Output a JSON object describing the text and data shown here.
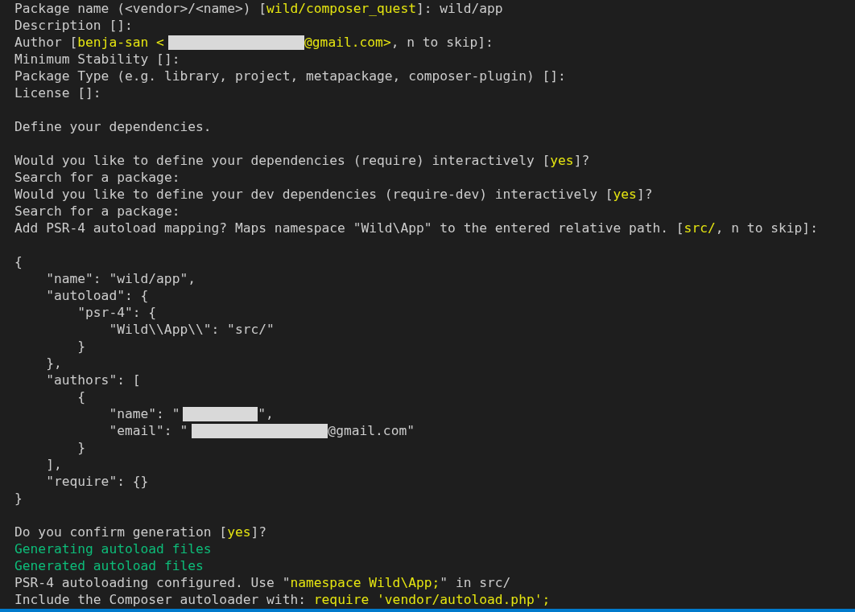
{
  "terminal": {
    "blocks": [
      {
        "lines": [
          {
            "segments": [
              {
                "kind": "plain",
                "text": "Package name (<vendor>/<name>) ["
              },
              {
                "kind": "accent",
                "text": "wild/composer_quest"
              },
              {
                "kind": "plain",
                "text": "]: wild/app"
              }
            ]
          },
          {
            "segments": [
              {
                "kind": "plain",
                "text": "Description []:"
              }
            ]
          },
          {
            "segments": [
              {
                "kind": "plain",
                "text": "Author ["
              },
              {
                "kind": "accent",
                "text": "benja-san <"
              },
              {
                "kind": "redacted"
              },
              {
                "kind": "accent",
                "text": "@gmail.com>"
              },
              {
                "kind": "plain",
                "text": ", n to skip]:"
              }
            ]
          },
          {
            "segments": [
              {
                "kind": "plain",
                "text": "Minimum Stability []:"
              }
            ]
          },
          {
            "segments": [
              {
                "kind": "plain",
                "text": "Package Type (e.g. library, project, metapackage, composer-plugin) []:"
              }
            ]
          },
          {
            "segments": [
              {
                "kind": "plain",
                "text": "License []:"
              }
            ]
          }
        ]
      },
      {
        "lines": [
          {
            "segments": [
              {
                "kind": "plain",
                "text": "Define your dependencies."
              }
            ]
          }
        ]
      },
      {
        "lines": [
          {
            "segments": [
              {
                "kind": "plain",
                "text": "Would you like to define your dependencies (require) interactively ["
              },
              {
                "kind": "accent",
                "text": "yes"
              },
              {
                "kind": "plain",
                "text": "]?"
              }
            ]
          },
          {
            "segments": [
              {
                "kind": "plain",
                "text": "Search for a package:"
              }
            ]
          },
          {
            "segments": [
              {
                "kind": "plain",
                "text": "Would you like to define your dev dependencies (require-dev) interactively ["
              },
              {
                "kind": "accent",
                "text": "yes"
              },
              {
                "kind": "plain",
                "text": "]?"
              }
            ]
          },
          {
            "segments": [
              {
                "kind": "plain",
                "text": "Search for a package:"
              }
            ]
          },
          {
            "segments": [
              {
                "kind": "plain",
                "text": "Add PSR-4 autoload mapping? Maps namespace \"Wild\\App\" to the entered relative path. ["
              },
              {
                "kind": "accent",
                "text": "src/"
              },
              {
                "kind": "plain",
                "text": ", n to skip]:"
              }
            ]
          }
        ]
      },
      {
        "lines": [
          {
            "segments": [
              {
                "kind": "plain",
                "text": "{"
              }
            ],
            "children": [
              {
                "segments": [
                  {
                    "kind": "plain",
                    "text": "\"name\": \"wild/app\","
                  }
                ]
              },
              {
                "segments": [
                  {
                    "kind": "plain",
                    "text": "\"autoload\": {"
                  }
                ],
                "children": [
                  {
                    "segments": [
                      {
                        "kind": "plain",
                        "text": "\"psr-4\": {"
                      }
                    ],
                    "children": [
                      {
                        "segments": [
                          {
                            "kind": "plain",
                            "text": "\"Wild\\\\App\\\\\": \"src/\""
                          }
                        ]
                      }
                    ]
                  },
                  {
                    "segments": [
                      {
                        "kind": "plain",
                        "text": "}"
                      }
                    ]
                  }
                ]
              },
              {
                "segments": [
                  {
                    "kind": "plain",
                    "text": "},"
                  }
                ]
              },
              {
                "segments": [
                  {
                    "kind": "plain",
                    "text": "\"authors\": ["
                  }
                ],
                "children": [
                  {
                    "segments": [
                      {
                        "kind": "plain",
                        "text": "{"
                      }
                    ],
                    "children": [
                      {
                        "segments": [
                          {
                            "kind": "plain",
                            "text": "\"name\": \""
                          },
                          {
                            "kind": "redacted_short"
                          },
                          {
                            "kind": "plain",
                            "text": "\","
                          }
                        ]
                      },
                      {
                        "segments": [
                          {
                            "kind": "plain",
                            "text": "\"email\": \""
                          },
                          {
                            "kind": "redacted"
                          },
                          {
                            "kind": "plain",
                            "text": "@gmail.com\""
                          }
                        ]
                      }
                    ]
                  },
                  {
                    "segments": [
                      {
                        "kind": "plain",
                        "text": "}"
                      }
                    ]
                  }
                ]
              },
              {
                "segments": [
                  {
                    "kind": "plain",
                    "text": "],"
                  }
                ]
              },
              {
                "segments": [
                  {
                    "kind": "plain",
                    "text": "\"require\": {}"
                  }
                ]
              }
            ]
          },
          {
            "segments": [
              {
                "kind": "plain",
                "text": "}"
              }
            ]
          }
        ]
      },
      {
        "lines": [
          {
            "segments": [
              {
                "kind": "plain",
                "text": "Do you confirm generation ["
              },
              {
                "kind": "accent",
                "text": "yes"
              },
              {
                "kind": "plain",
                "text": "]?"
              }
            ]
          },
          {
            "segments": [
              {
                "kind": "success",
                "text": "Generating autoload files"
              }
            ]
          },
          {
            "segments": [
              {
                "kind": "success",
                "text": "Generated autoload files"
              }
            ]
          },
          {
            "segments": [
              {
                "kind": "plain",
                "text": "PSR-4 autoloading configured. Use \""
              },
              {
                "kind": "accent",
                "text": "namespace Wild\\App;"
              },
              {
                "kind": "plain",
                "text": "\" in src/"
              }
            ]
          },
          {
            "segments": [
              {
                "kind": "plain",
                "text": "Include the Composer autoloader with: "
              },
              {
                "kind": "accent",
                "text": "require 'vendor/autoload.php';"
              }
            ]
          }
        ]
      }
    ]
  }
}
